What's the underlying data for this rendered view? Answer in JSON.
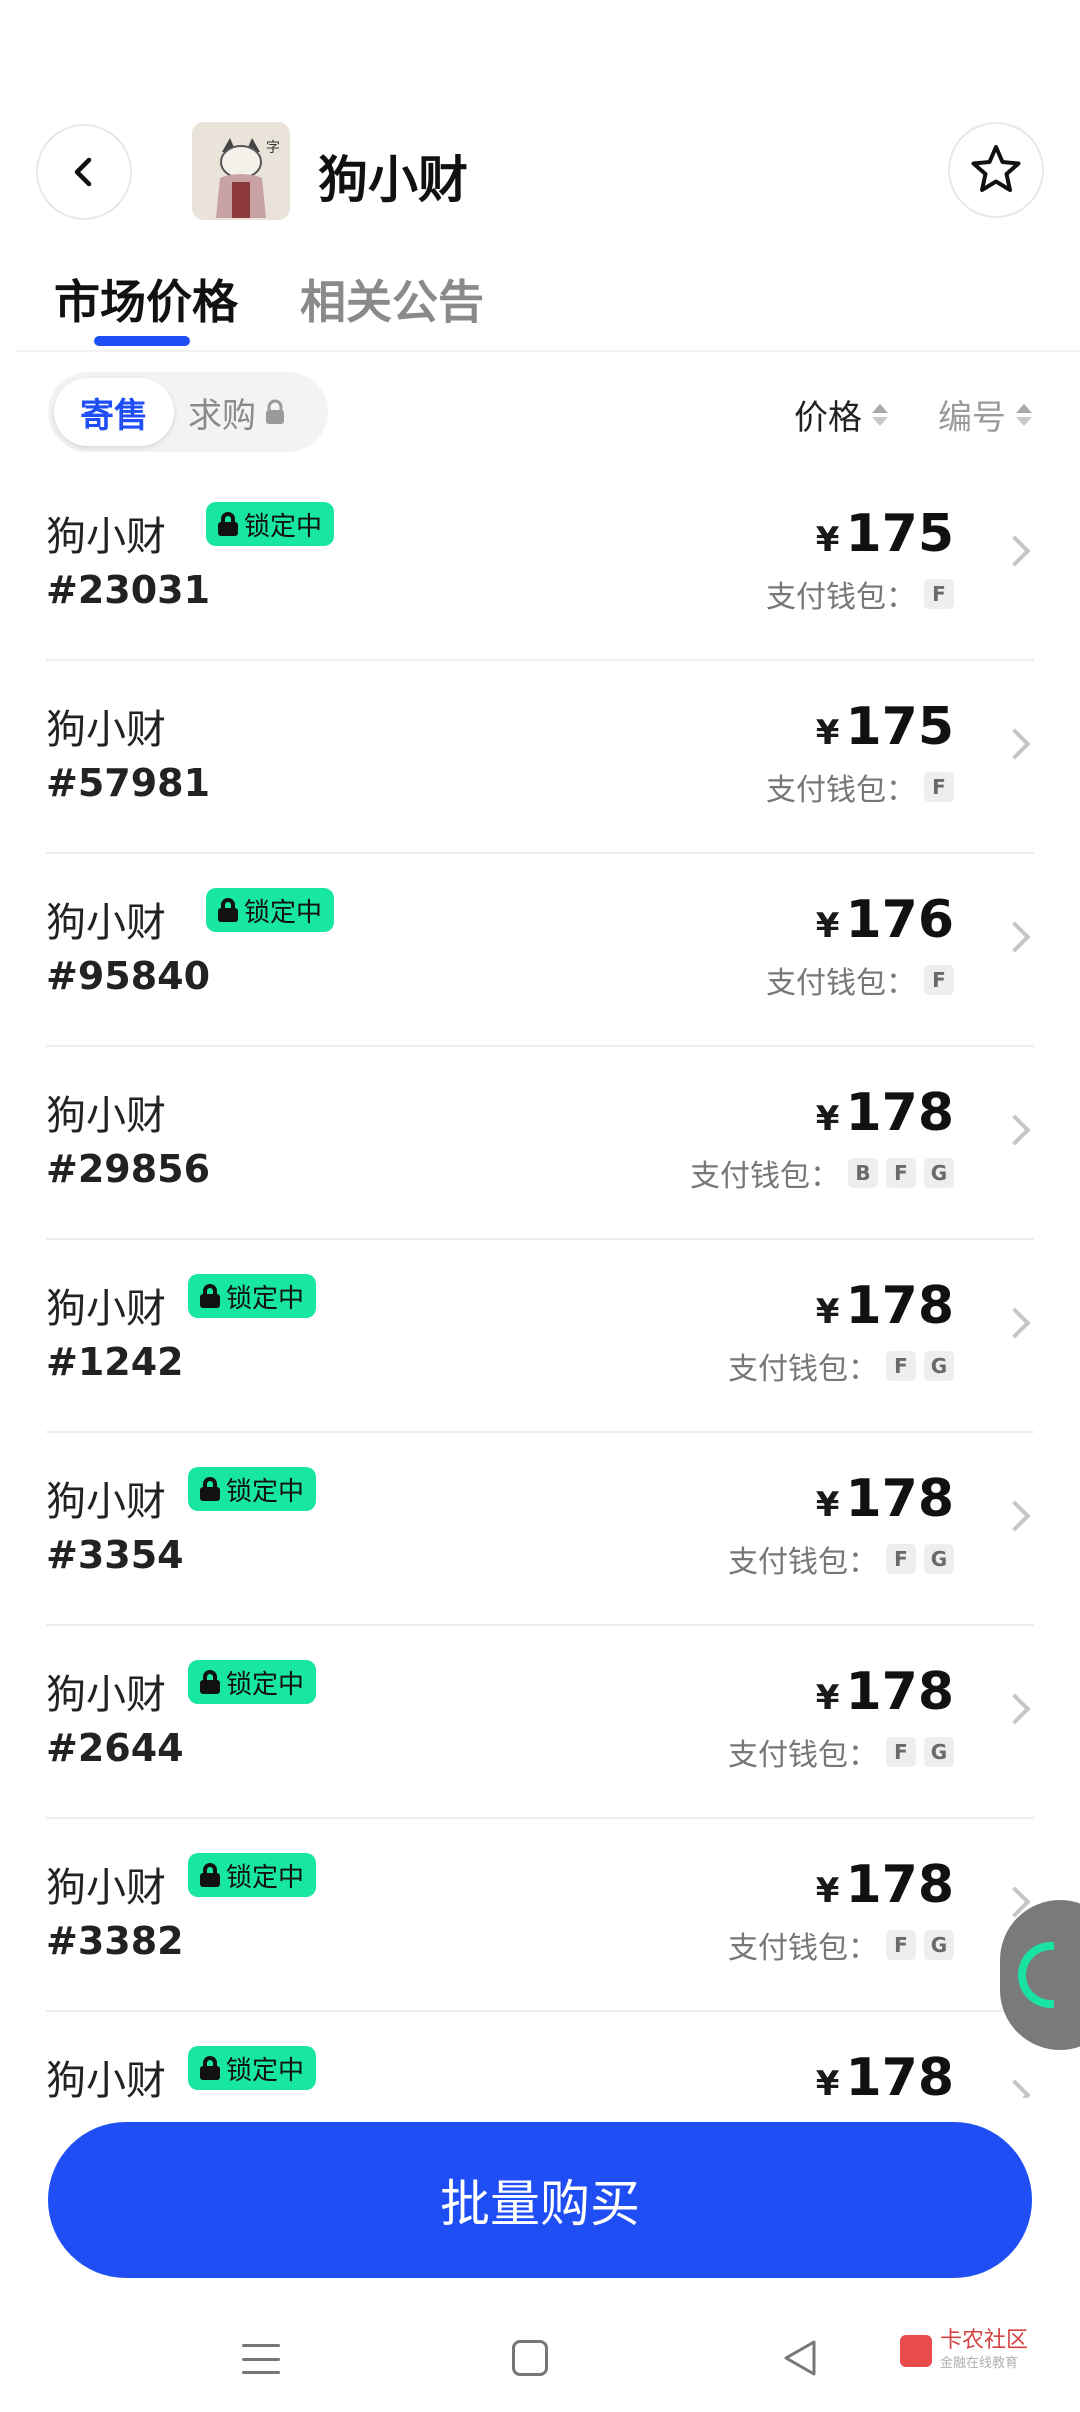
{
  "header": {
    "title": "狗小财"
  },
  "tabs": {
    "active": "市场价格",
    "inactive": "相关公告"
  },
  "filter": {
    "sell": "寄售",
    "buy": "求购"
  },
  "sort": {
    "price": "价格",
    "id": "编号"
  },
  "labels": {
    "yen": "¥",
    "wallet": "支付钱包：",
    "locked": "锁定中"
  },
  "items": [
    {
      "name": "狗小财",
      "number": "#23031",
      "locked": true,
      "price": "175",
      "wallets": [
        "F"
      ]
    },
    {
      "name": "狗小财",
      "number": "#57981",
      "locked": false,
      "price": "175",
      "wallets": [
        "F"
      ]
    },
    {
      "name": "狗小财",
      "number": "#95840",
      "locked": true,
      "price": "176",
      "wallets": [
        "F"
      ]
    },
    {
      "name": "狗小财",
      "number": "#29856",
      "locked": false,
      "price": "178",
      "wallets": [
        "B",
        "F",
        "G"
      ]
    },
    {
      "name": "狗小财",
      "number": "#1242",
      "locked": true,
      "price": "178",
      "wallets": [
        "F",
        "G"
      ]
    },
    {
      "name": "狗小财",
      "number": "#3354",
      "locked": true,
      "price": "178",
      "wallets": [
        "F",
        "G"
      ]
    },
    {
      "name": "狗小财",
      "number": "#2644",
      "locked": true,
      "price": "178",
      "wallets": [
        "F",
        "G"
      ]
    },
    {
      "name": "狗小财",
      "number": "#3382",
      "locked": true,
      "price": "178",
      "wallets": [
        "F",
        "G"
      ]
    },
    {
      "name": "狗小财",
      "number": "",
      "locked": true,
      "price": "178",
      "wallets": []
    }
  ],
  "footer": {
    "batch_buy": "批量购买"
  },
  "watermark": {
    "text": "卡农社区",
    "sub": "金融在线教育"
  },
  "colors": {
    "accent": "#1f4ef5",
    "lock_badge": "#18e7a0"
  }
}
